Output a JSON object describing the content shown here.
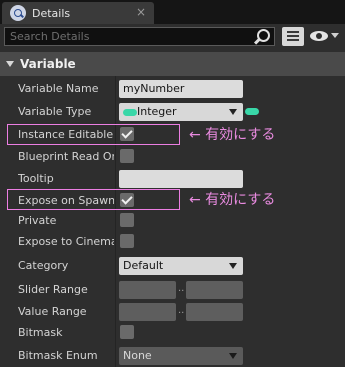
{
  "tab": {
    "title": "Details",
    "close_glyph": "×"
  },
  "search": {
    "placeholder": "Search Details"
  },
  "section": {
    "title": "Variable"
  },
  "properties": {
    "variable_name": {
      "label": "Variable Name",
      "value": "myNumber"
    },
    "variable_type": {
      "label": "Variable Type",
      "value": "Integer",
      "pin_color": "#39d7a8"
    },
    "instance_editable": {
      "label": "Instance Editable",
      "checked": true
    },
    "blueprint_read_only": {
      "label": "Blueprint Read Only",
      "checked": false
    },
    "tooltip": {
      "label": "Tooltip",
      "value": ""
    },
    "expose_on_spawn": {
      "label": "Expose on Spawn",
      "checked": true
    },
    "private": {
      "label": "Private",
      "checked": false
    },
    "expose_to_cinematics": {
      "label": "Expose to Cinematics",
      "checked": false
    },
    "category": {
      "label": "Category",
      "value": "Default"
    },
    "slider_range": {
      "label": "Slider Range",
      "min": "",
      "max": "",
      "separator": ".."
    },
    "value_range": {
      "label": "Value Range",
      "min": "",
      "max": "",
      "separator": ".."
    },
    "bitmask": {
      "label": "Bitmask",
      "checked": false
    },
    "bitmask_enum": {
      "label": "Bitmask Enum",
      "value": "None"
    }
  },
  "annotations": {
    "instance_editable_note": "← 有効にする",
    "expose_on_spawn_note": "← 有効にする",
    "highlight_color": "#ec7ee2"
  },
  "icons": {
    "tab": "details-info-icon",
    "search": "search-icon",
    "matrix": "property-matrix-icon",
    "eye": "eye-icon"
  }
}
